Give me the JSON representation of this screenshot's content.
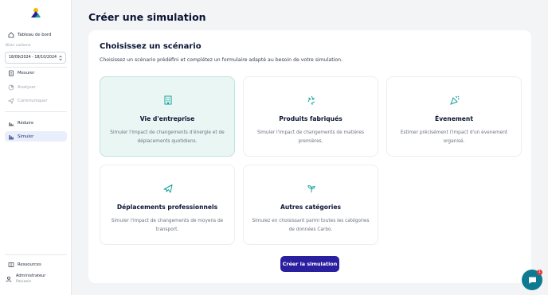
{
  "sidebar": {
    "dashboard_label": "Tableau de bord",
    "bilan_label": "Bilan carbone",
    "date_range": "18/09/2024 - 18/10/2024",
    "items": [
      {
        "label": "Mesurer",
        "icon": "clipboard-icon",
        "disabled": false
      },
      {
        "label": "Analyser",
        "icon": "chart-pie-icon",
        "disabled": true
      },
      {
        "label": "Communiquer",
        "icon": "send-icon",
        "disabled": true
      },
      {
        "label": "Réduire",
        "icon": "bar-chart-icon",
        "disabled": false
      },
      {
        "label": "Simuler",
        "icon": "stack-chart-icon",
        "disabled": false,
        "active": true
      }
    ],
    "resources_label": "Ressources",
    "user_name": "Administrateur",
    "user_role": "Paniaein"
  },
  "page": {
    "title": "Créer une simulation"
  },
  "main": {
    "heading": "Choisissez un scénario",
    "subtitle": "Choisissez un scénario prédéfini et complétez un formulaire adapté au besoin de votre simulation.",
    "scenarios": [
      {
        "title": "Vie d'entreprise",
        "description": "Simuler l'impact de changements d'énergie et de déplacements quotidiens.",
        "icon": "building-icon",
        "selected": true
      },
      {
        "title": "Produits fabriqués",
        "description": "Simuler l'impact de changements de matières premières.",
        "icon": "recycle-icon",
        "selected": false
      },
      {
        "title": "Évenement",
        "description": "Estimer précisément l'impact d'un évenement organisé.",
        "icon": "party-popper-icon",
        "selected": false
      },
      {
        "title": "Déplacements professionnels",
        "description": "Simuler l'impact de changements de moyens de transport.",
        "icon": "plane-icon",
        "selected": false
      },
      {
        "title": "Autres catégories",
        "description": "Simulez en choisissant parmi toutes les catégories de données Carbo.",
        "icon": "sprout-icon",
        "selected": false
      }
    ],
    "cta_label": "Créer la simulation"
  },
  "chat": {
    "badge_count": "1"
  },
  "colors": {
    "accent": "#2a1f9e",
    "teal": "#14a39a",
    "selected_tile_bg": "#eaf6f4",
    "active_nav_bg": "#e8eefb",
    "chat": "#0e7a91",
    "badge": "#e23b3b"
  }
}
